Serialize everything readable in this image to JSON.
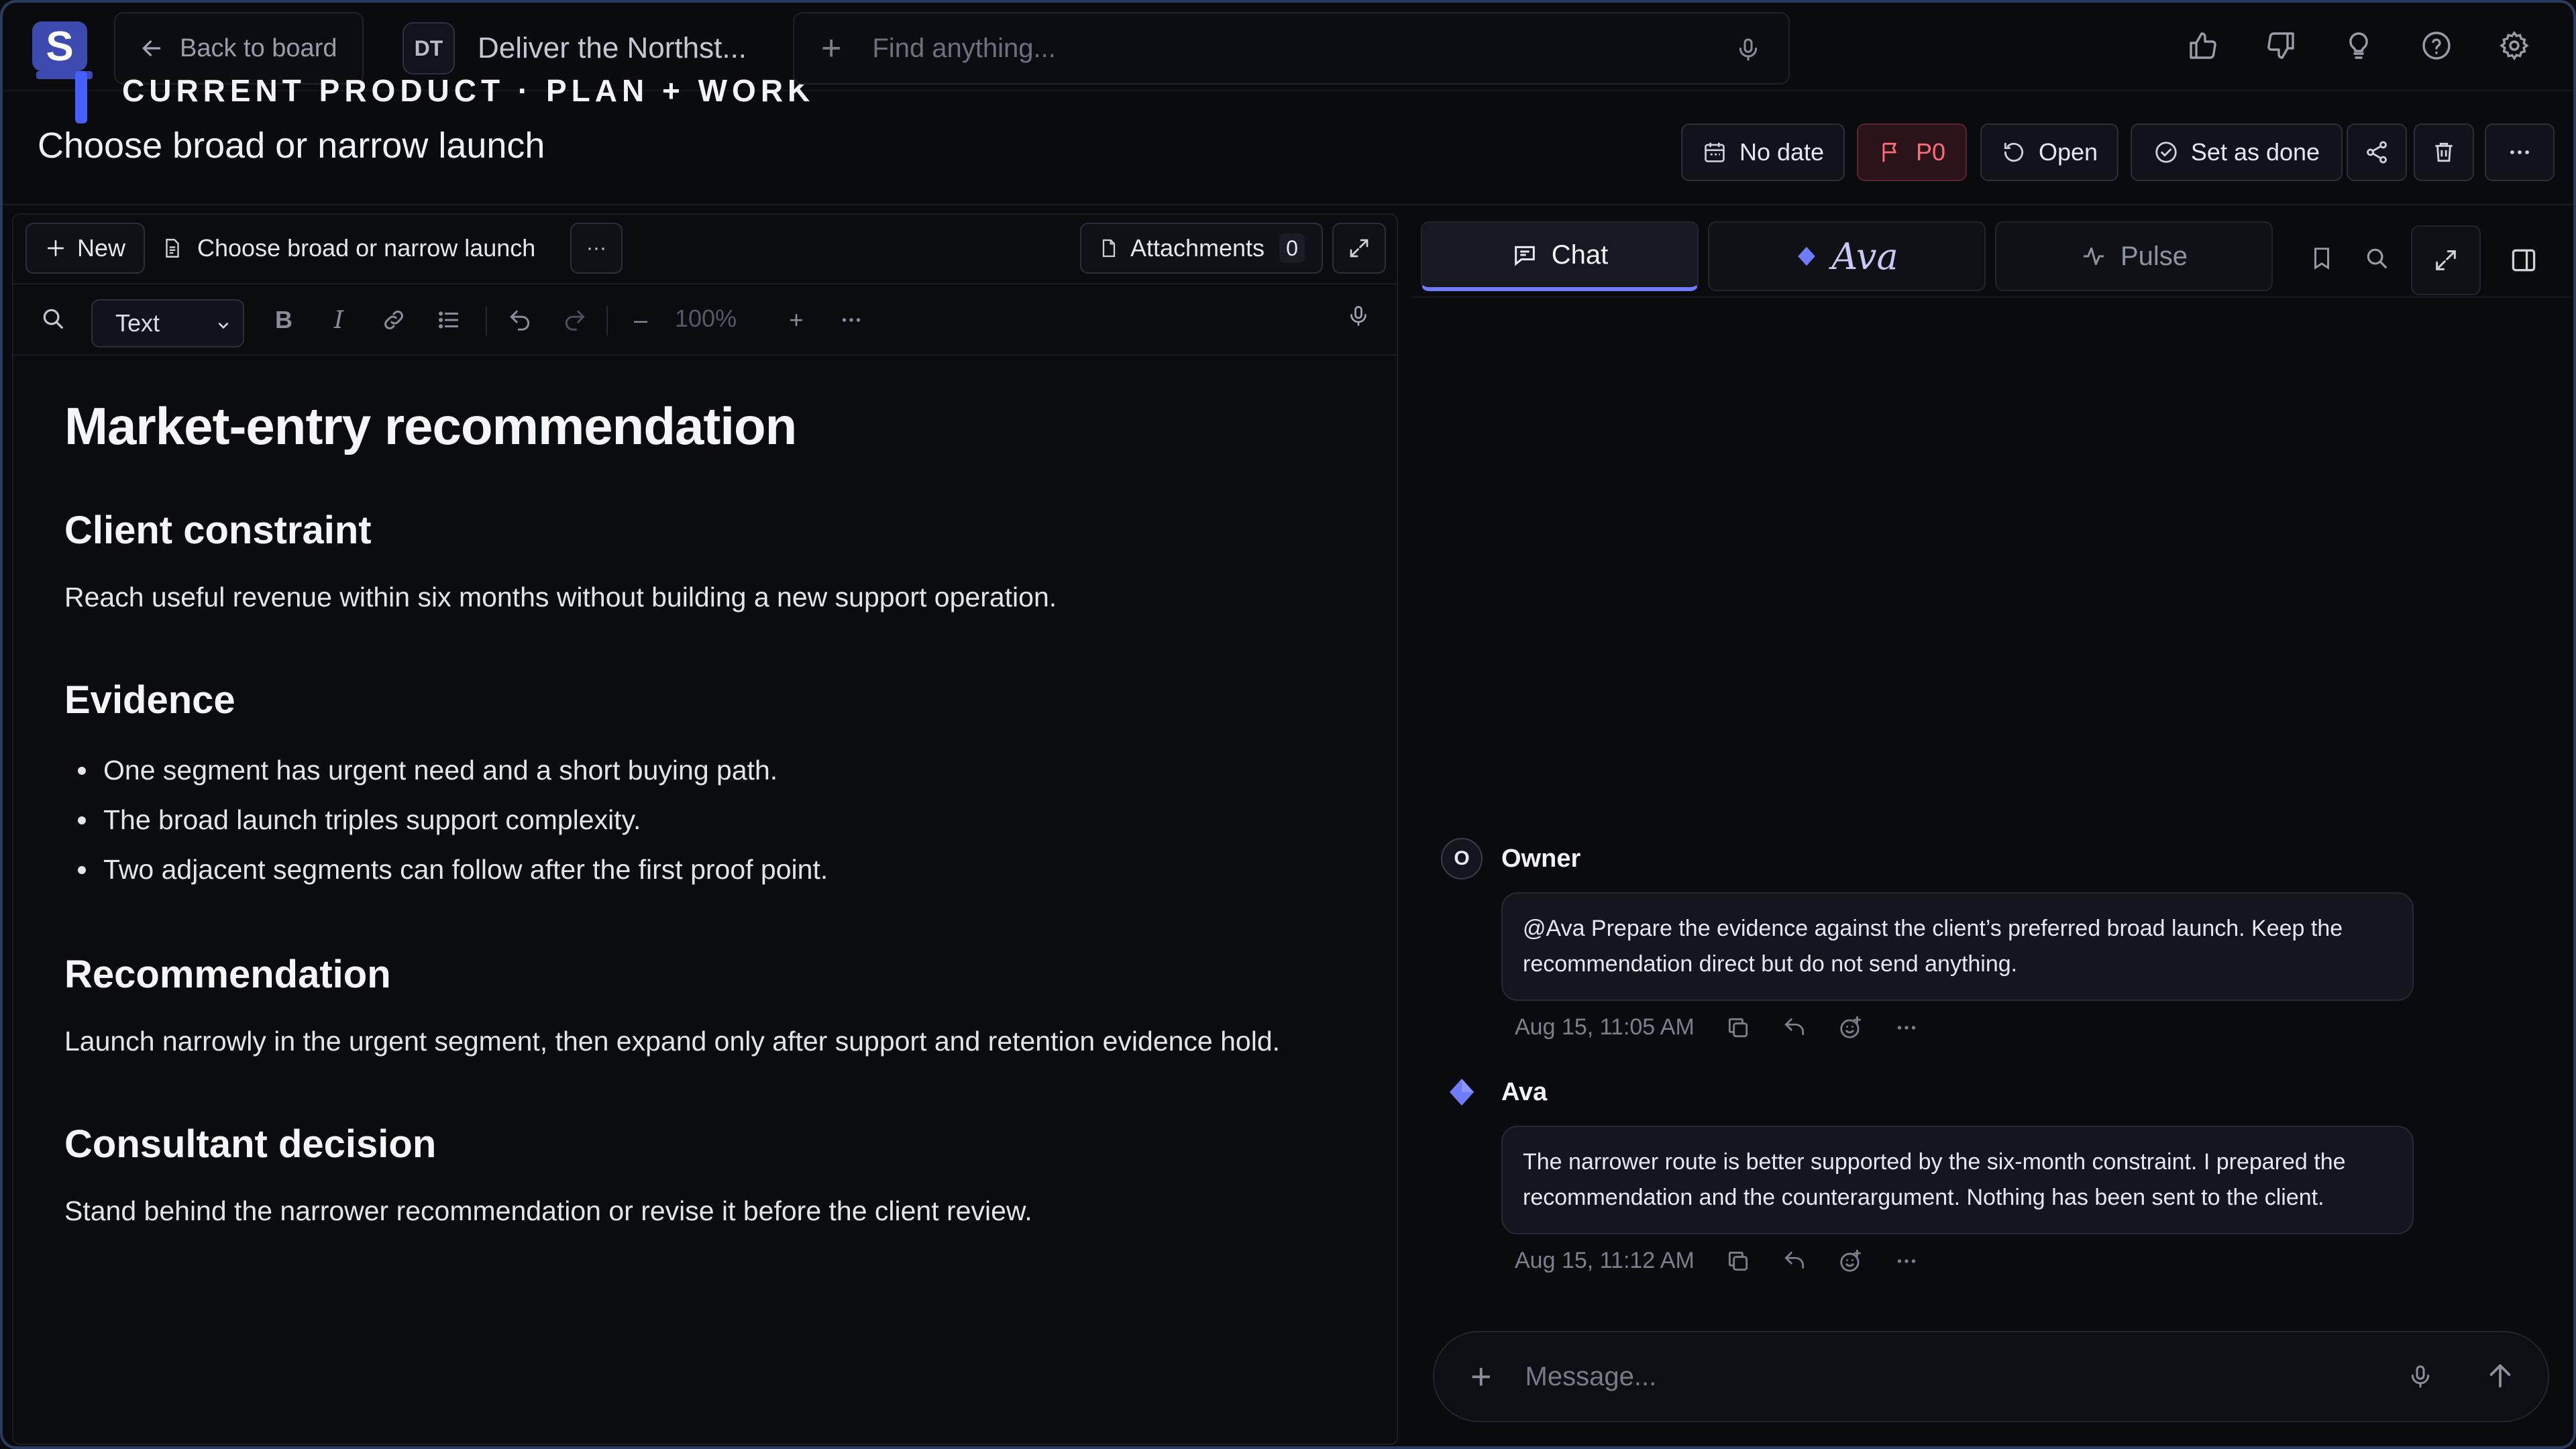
{
  "app": {
    "logo_letter": "S",
    "back_label": "Back to board",
    "project_badge": "DT",
    "project_name": "Deliver the Northst...",
    "subtitle": "CURRENT PRODUCT · PLAN + WORK",
    "search_placeholder": "Find anything..."
  },
  "task": {
    "title": "Choose broad or narrow launch",
    "date_label": "No date",
    "priority_label": "P0",
    "status_label": "Open",
    "done_label": "Set as done"
  },
  "editor": {
    "new_label": "New",
    "doc_tab": "Choose broad or narrow launch",
    "more_label": "···",
    "attachments_label": "Attachments",
    "attachments_count": "0",
    "format_select": "Text",
    "zoom": "100%",
    "zoom_minus": "–",
    "zoom_plus": "+"
  },
  "doc": {
    "h1": "Market-entry recommendation",
    "s1_title": "Client constraint",
    "s1_body": "Reach useful revenue within six months without building a new support operation.",
    "s2_title": "Evidence",
    "s2_items": [
      "One segment has urgent need and a short buying path.",
      "The broad launch triples support complexity.",
      "Two adjacent segments can follow after the first proof point."
    ],
    "s3_title": "Recommendation",
    "s3_body": "Launch narrowly in the urgent segment, then expand only after support and retention evidence hold.",
    "s4_title": "Consultant decision",
    "s4_body": "Stand behind the narrower recommendation or revise it before the client review."
  },
  "chat": {
    "tab_chat": "Chat",
    "tab_ava": "Ava",
    "tab_pulse": "Pulse",
    "messages": [
      {
        "avatar": "O",
        "author": "Owner",
        "text": "@Ava Prepare the evidence against the client’s preferred broad launch. Keep the recommendation direct but do not send anything.",
        "time": "Aug 15, 11:05 AM"
      },
      {
        "author": "Ava",
        "text": "The narrower route is better supported by the six-month constraint. I prepared the recommendation and the counterargument. Nothing has been sent to the client.",
        "time": "Aug 15, 11:12 AM"
      }
    ],
    "composer_placeholder": "Message..."
  },
  "colors": {
    "accent": "#6f7cff",
    "priority": "#ff6b7a",
    "logo": "#3d4bb0"
  }
}
